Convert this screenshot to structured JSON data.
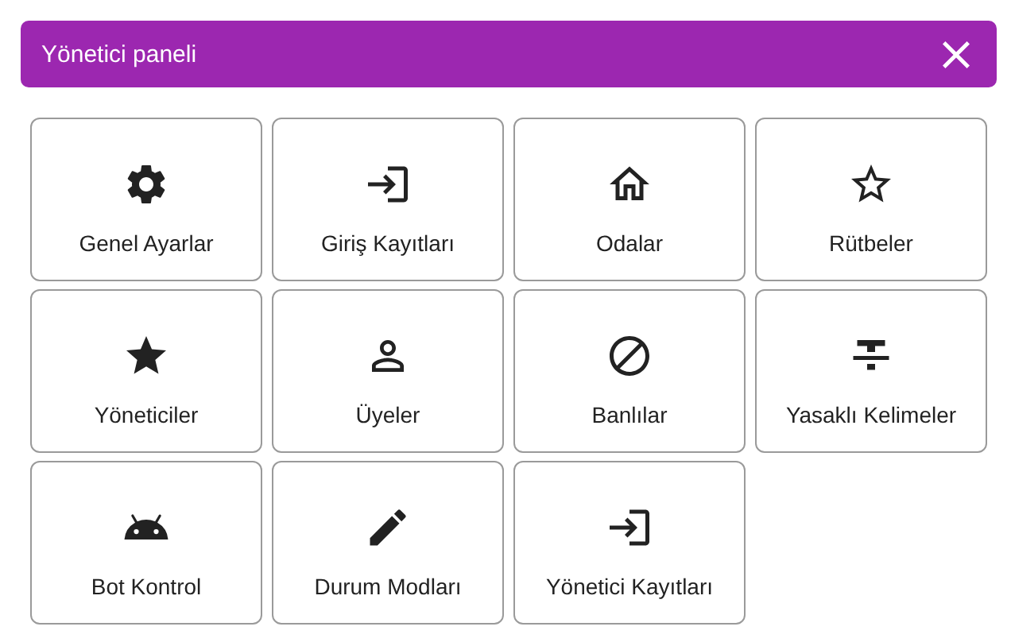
{
  "header": {
    "title": "Yönetici paneli"
  },
  "items": [
    {
      "label": "Genel Ayarlar"
    },
    {
      "label": "Giriş Kayıtları"
    },
    {
      "label": "Odalar"
    },
    {
      "label": "Rütbeler"
    },
    {
      "label": "Yöneticiler"
    },
    {
      "label": "Üyeler"
    },
    {
      "label": "Banlılar"
    },
    {
      "label": "Yasaklı Kelimeler"
    },
    {
      "label": "Bot Kontrol"
    },
    {
      "label": "Durum Modları"
    },
    {
      "label": "Yönetici Kayıtları"
    }
  ]
}
